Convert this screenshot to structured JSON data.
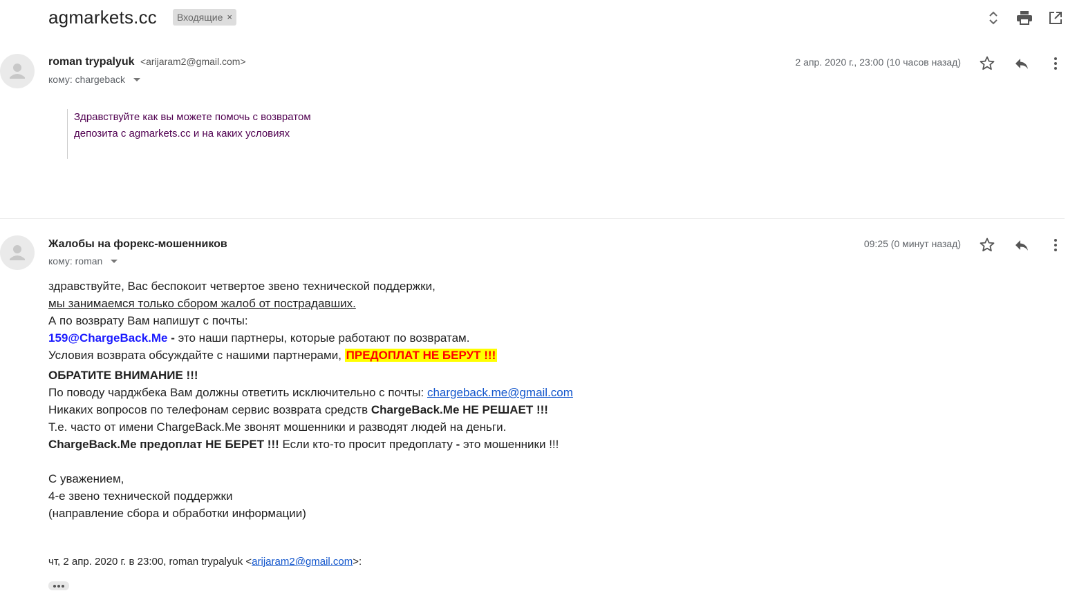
{
  "header": {
    "subject": "agmarkets.cc",
    "label": "Входящие",
    "label_remove": "×"
  },
  "messages": [
    {
      "sender_name": "roman trypalyuk",
      "sender_email": "<arijaram2@gmail.com>",
      "to_line": "кому: chargeback",
      "date": "2 апр. 2020 г., 23:00 (10 часов назад)",
      "quote_lines": [
        "Здравствуйте как вы можете помочь с возвратом",
        "депозита с agmarkets.cc и на каких условиях"
      ]
    },
    {
      "sender_name": "Жалобы на форекс-мошенников",
      "to_line": "кому: roman",
      "date": "09:25 (0 минут назад)",
      "body": {
        "l1": "здравствуйте, Вас беспокоит четвертое звено технической поддержки,",
        "l2": "мы занимаемся только сбором жалоб от пострадавших.",
        "l3": "А по возврату Вам напишут с почты:",
        "l4_email": "159@ChargeBack.Me",
        "l4_dash": " - ",
        "l4_rest": "это наши партнеры, которые работают по возвратам.",
        "l5_text": "Условия возврата обсуждайте с нашими партнерами, ",
        "l5_highlight": "ПРЕДОПЛАТ НЕ БЕРУТ !!!",
        "l6": "ОБРАТИТЕ ВНИМАНИЕ !!!",
        "l7_text": "По поводу чарджбека Вам должны ответить исключительно с почты: ",
        "l7_link": "chargeback.me@gmail.com",
        "l8_text": "Никаких вопросов по телефонам сервис возврата средств ",
        "l8_bold": "ChargeBack.Me НЕ РЕШАЕТ !!!",
        "l9": "Т.е. часто от имени ChargeBack.Me звонят мошенники и разводят людей на деньги.",
        "l10_bold": "ChargeBack.Me предоплат НЕ БЕРЕТ !!!",
        "l10_text": " Если кто-то просит предоплату ",
        "l10_dash": "-",
        "l10_end": " это мошенники !!!"
      },
      "signature": [
        "С уважением,",
        "4-е звено технической поддержки",
        "(направление сбора и обработки информации)"
      ],
      "attribution_prefix": "чт, 2 апр. 2020 г. в 23:00, roman trypalyuk <",
      "attribution_email": "arijaram2@gmail.com",
      "attribution_suffix": ">:"
    }
  ],
  "colors": {
    "quote_text": "#500050",
    "highlight_bg": "#ffff00",
    "highlight_text": "#ff0000",
    "partner_email": "#1a1aff",
    "link": "#1155cc"
  },
  "icons": {
    "expand": "unfold-icon",
    "print": "print-icon",
    "new_window": "open-in-new-icon",
    "star": "star-icon",
    "reply": "reply-icon",
    "more": "more-vert-icon",
    "avatar": "person-icon"
  }
}
